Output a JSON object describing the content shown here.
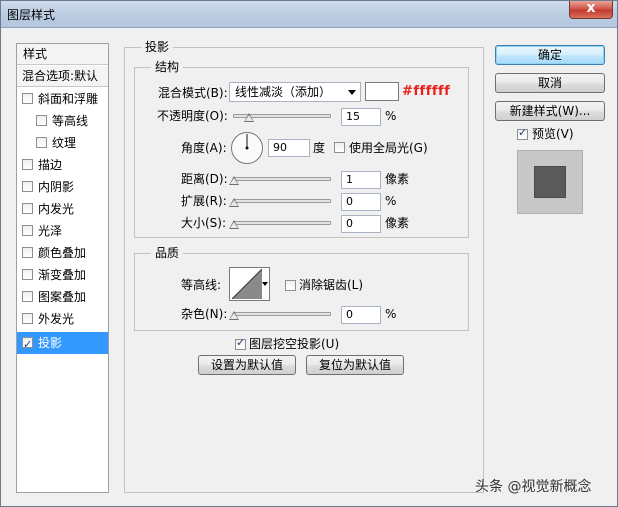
{
  "window": {
    "title": "图层样式",
    "close_glyph": "x"
  },
  "style_list": {
    "header": "样式",
    "blend_options": "混合选项:默认",
    "items": [
      {
        "label": "斜面和浮雕",
        "checked": false
      },
      {
        "label": "等高线",
        "checked": false
      },
      {
        "label": "纹理",
        "checked": false
      },
      {
        "label": "描边",
        "checked": false
      },
      {
        "label": "内阴影",
        "checked": false
      },
      {
        "label": "内发光",
        "checked": false
      },
      {
        "label": "光泽",
        "checked": false
      },
      {
        "label": "颜色叠加",
        "checked": false
      },
      {
        "label": "渐变叠加",
        "checked": false
      },
      {
        "label": "图案叠加",
        "checked": false
      },
      {
        "label": "外发光",
        "checked": false
      },
      {
        "label": "投影",
        "checked": true
      }
    ]
  },
  "drop_shadow": {
    "section_title": "投影",
    "structure": {
      "title": "结构",
      "blend_mode_label": "混合模式(B):",
      "blend_mode_value": "线性减淡（添加）",
      "color_swatch": "#ffffff",
      "color_annotation": "#ffffff",
      "opacity_label": "不透明度(O):",
      "opacity_value": "15",
      "opacity_unit": "%",
      "angle_label": "角度(A):",
      "angle_value": "90",
      "angle_unit": "度",
      "global_light_label": "使用全局光(G)",
      "distance_label": "距离(D):",
      "distance_value": "1",
      "distance_unit": "像素",
      "spread_label": "扩展(R):",
      "spread_value": "0",
      "spread_unit": "%",
      "size_label": "大小(S):",
      "size_value": "0",
      "size_unit": "像素"
    },
    "quality": {
      "title": "品质",
      "contour_label": "等高线:",
      "anti_alias_label": "消除锯齿(L)",
      "noise_label": "杂色(N):",
      "noise_value": "0",
      "noise_unit": "%"
    },
    "knockout_label": "图层挖空投影(U)",
    "make_default": "设置为默认值",
    "reset_default": "复位为默认值"
  },
  "buttons": {
    "ok": "确定",
    "cancel": "取消",
    "new_style": "新建样式(W)...",
    "preview_label": "预览(V)"
  },
  "watermark": "头条 @视觉新概念",
  "colors": {
    "annotation": "#e8201a",
    "selection": "#3399ff"
  }
}
